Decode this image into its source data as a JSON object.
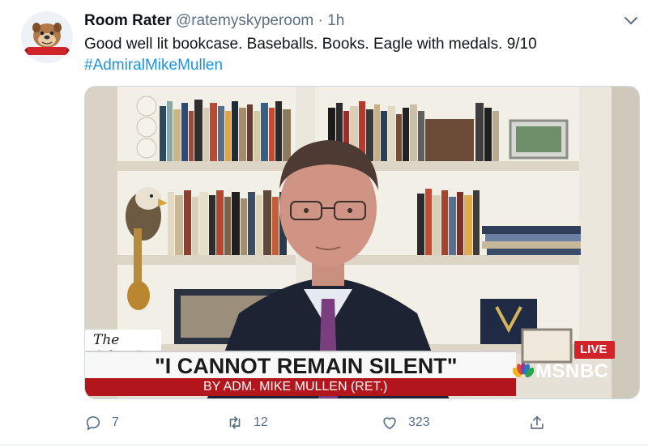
{
  "tweet": {
    "author_name": "Room Rater",
    "handle": "@ratemyskyperoom",
    "separator": "·",
    "time": "1h",
    "text": "Good well lit bookcase. Baseballs. Books. Eagle with medals. 9/10",
    "hashtag": "#AdmiralMikeMullen"
  },
  "avatar": {
    "logo_text": "ROOM RATER"
  },
  "media": {
    "brand_logo": "The Atlantic",
    "headline": "\"I CANNOT REMAIN SILENT\"",
    "byline": "BY ADM. MIKE MULLEN (RET.)",
    "live_label": "LIVE",
    "network": "MSNBC"
  },
  "actions": {
    "replies": "7",
    "retweets": "12",
    "likes": "323"
  },
  "colors": {
    "accent": "#1b95e0",
    "muted": "#5b7083",
    "live_red": "#d1232a",
    "byline_red": "#b3151c"
  },
  "icons": [
    "chevron-down-icon",
    "reply-icon",
    "retweet-icon",
    "like-icon",
    "share-icon"
  ]
}
